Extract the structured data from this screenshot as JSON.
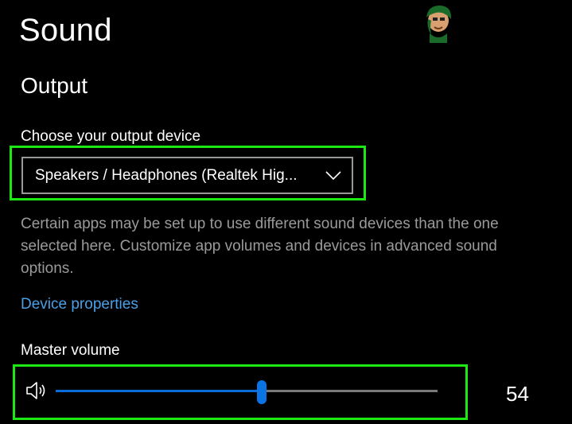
{
  "header": {
    "title": "Sound"
  },
  "output": {
    "section_title": "Output",
    "device_label": "Choose your output device",
    "device_value": "Speakers / Headphones (Realtek Hig...",
    "help_text": "Certain apps may be set up to use different sound devices than the one selected here. Customize app volumes and devices in advanced sound options.",
    "device_properties_link": "Device properties",
    "master_volume_label": "Master volume",
    "master_volume": 54
  },
  "icons": {
    "dropdown": "chevron-down-icon",
    "volume": "speaker-icon",
    "logo": "appuals-logo-icon"
  },
  "colors": {
    "background": "#000000",
    "highlight": "#1ee814",
    "accent": "#0a74e4",
    "link": "#4aa0e6",
    "secondary_text": "#9a9a9a"
  }
}
